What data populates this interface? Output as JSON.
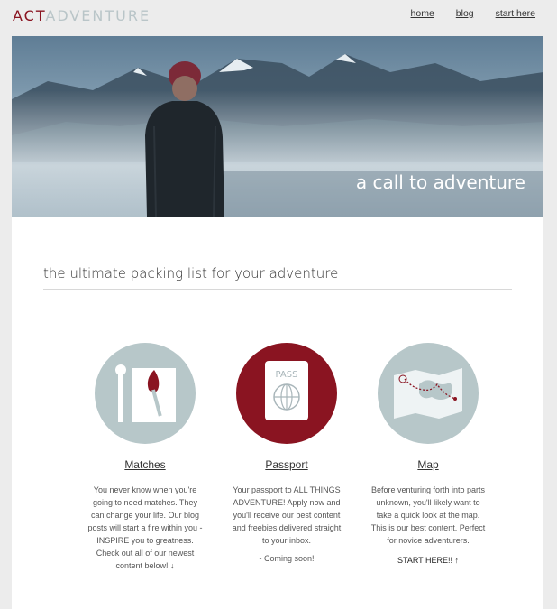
{
  "header": {
    "logo_act": "ACT",
    "logo_adventure": "ADVENTURE",
    "nav": [
      "home",
      "blog",
      "start here"
    ]
  },
  "hero": {
    "caption": "a call to adventure"
  },
  "main": {
    "title": "the ultimate packing list for your adventure",
    "features": [
      {
        "icon": "matches-icon",
        "title": "Matches",
        "description": "You never know when you're going to need matches. They can change your life. Our blog posts will start a fire within you - INSPIRE you to greatness. Check out all of our newest content below! ↓",
        "note": "",
        "cta": ""
      },
      {
        "icon": "passport-icon",
        "title": "Passport",
        "description": "Your passport to ALL THINGS ADVENTURE! Apply now and you'll receive our best content and freebies delivered straight to your inbox.",
        "note": "- Coming soon!",
        "cta": "",
        "icon_text": "PASS"
      },
      {
        "icon": "map-icon",
        "title": "Map",
        "description": "Before venturing forth into parts unknown, you'll likely want to take a quick look at the map. This is our best content. Perfect for novice adventurers.",
        "note": "",
        "cta": "START HERE!! ↑"
      }
    ]
  },
  "colors": {
    "brand_red": "#8a1421",
    "sage": "#b9c5c8",
    "background": "#ececec"
  }
}
